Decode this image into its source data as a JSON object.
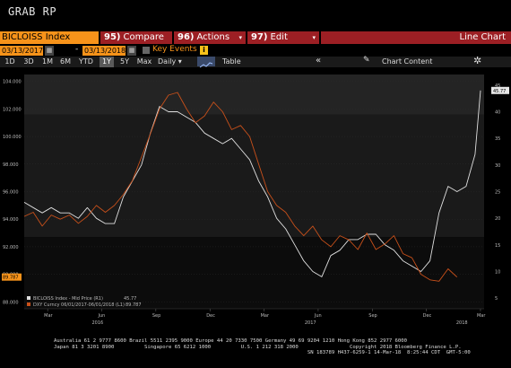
{
  "screen_title": "GRAB RP",
  "toolbar": {
    "ticker": "BICLOISS Index",
    "compare_num": "95)",
    "compare_label": "Compare",
    "actions_num": "96)",
    "actions_label": "Actions",
    "edit_num": "97)",
    "edit_label": "Edit",
    "view_label": "Line Chart",
    "caret": "▾"
  },
  "range": {
    "start_date": "03/13/2017",
    "dash": "-",
    "end_date": "03/13/2018",
    "key_events_label": "Key Events",
    "info_badge": "i"
  },
  "periods": [
    "1D",
    "3D",
    "1M",
    "6M",
    "YTD",
    "1Y",
    "5Y",
    "Max"
  ],
  "selected_period": "1Y",
  "periodicity": "Daily ▾",
  "table_label": "Table",
  "chart_content_label": "Chart Content",
  "icons": {
    "calendar": "calendar-icon",
    "collapse": "double-chevron-left-icon",
    "pencil": "pencil-icon",
    "gear": "gear-icon",
    "chart": "line-chart-icon"
  },
  "colors": {
    "series_white": "#e0e0e0",
    "series_orange": "#c8501a",
    "accent_orange": "#f7931a",
    "toolbar_red": "#9c1f24",
    "plot_bg_top": "#242424",
    "plot_bg_mid": "#1a1a1a",
    "plot_bg_bot": "#0c0c0c"
  },
  "chart_data": {
    "type": "line",
    "title": "",
    "left_axis_ticks": [
      "104.000",
      "102.000",
      "100.000",
      "98.000",
      "96.000",
      "94.000",
      "92.000",
      "90.000",
      "88.000"
    ],
    "right_axis_ticks": [
      "45",
      "40",
      "35",
      "30",
      "25",
      "20",
      "15",
      "10",
      "5"
    ],
    "x_month_ticks": [
      "Mar",
      "Jun",
      "Sep",
      "Dec",
      "Mar",
      "Jun",
      "Sep",
      "Dec",
      "Mar"
    ],
    "x_year_ticks": [
      "2016",
      "2017",
      "2018"
    ],
    "left_ylim": [
      87.5,
      104.5
    ],
    "right_ylim": [
      3,
      47
    ],
    "series": [
      {
        "name": "BICLOISS Index - Mid Price (R1)",
        "last_value": "45.77",
        "axis": "right",
        "color": "#e0e0e0",
        "x_month": [
          0,
          0.5,
          1,
          1.5,
          2,
          2.5,
          3,
          3.5,
          4,
          4.5,
          5,
          5.5,
          6,
          6.5,
          7,
          7.5,
          8,
          8.5,
          9,
          9.5,
          10,
          10.5,
          11,
          11.5,
          12,
          12.5,
          13,
          13.5,
          14,
          14.5,
          15,
          15.5,
          16,
          16.5,
          17,
          17.5,
          18,
          18.5,
          19,
          19.5,
          20,
          20.5,
          21,
          21.5,
          22,
          22.5,
          23,
          23.5,
          24,
          24.5,
          25,
          25.3
        ],
        "y": [
          23,
          22,
          21,
          22,
          21,
          21,
          20,
          22,
          20,
          19,
          19,
          24,
          27,
          30,
          36,
          41,
          40,
          40,
          39,
          38,
          36,
          35,
          34,
          35,
          33,
          31,
          27,
          24,
          20,
          18,
          15,
          12,
          10,
          9,
          13,
          14,
          16,
          16,
          17,
          17,
          15,
          14,
          12,
          11,
          10,
          12,
          21,
          26,
          25,
          26,
          32,
          44
        ]
      },
      {
        "name": "DXY Curncy 06/01/2017-06/01/2018 (L1)",
        "last_value": "89.787",
        "axis": "left",
        "color": "#c8501a",
        "x_month": [
          0,
          0.5,
          1,
          1.5,
          2,
          2.5,
          3,
          3.5,
          4,
          4.5,
          5,
          5.5,
          6,
          6.5,
          7,
          7.5,
          8,
          8.5,
          9,
          9.5,
          10,
          10.5,
          11,
          11.5,
          12,
          12.5,
          13,
          13.5,
          14,
          14.5,
          15,
          15.5,
          16,
          16.5,
          17,
          17.5,
          18,
          18.5,
          19,
          19.5,
          20,
          20.5,
          21,
          21.5,
          22,
          22.5,
          23,
          23.5,
          24
        ],
        "y": [
          94.2,
          94.5,
          93.5,
          94.3,
          94.0,
          94.3,
          93.7,
          94.2,
          95.0,
          94.5,
          95.0,
          95.8,
          96.8,
          98.5,
          100.2,
          102.0,
          103.0,
          103.2,
          102.0,
          101.0,
          101.5,
          102.5,
          101.8,
          100.5,
          100.8,
          100.0,
          98.0,
          96.0,
          95.0,
          94.5,
          93.5,
          92.8,
          93.5,
          92.5,
          92.0,
          92.8,
          92.5,
          91.8,
          93.0,
          91.8,
          92.2,
          92.8,
          91.5,
          91.2,
          90.0,
          89.6,
          89.5,
          90.4,
          89.8
        ]
      }
    ],
    "legend_position": "bottom-left",
    "grid": false
  },
  "footer": {
    "line1": "Australia 61 2 9777 8600 Brazil 5511 2395 9000 Europe 44 20 7330 7500 Germany 49 69 9204 1210 Hong Kong 852 2977 6000",
    "line2": "Japan 81 3 3201 8900          Singapore 65 6212 1000          U.S. 1 212 318 2000                 Copyright 2018 Bloomberg Finance L.P.",
    "line3": "                                                                                    SN 183789 H437-6259-1 14-Mar-18  8:25:44 CDT  GMT-5:00"
  }
}
